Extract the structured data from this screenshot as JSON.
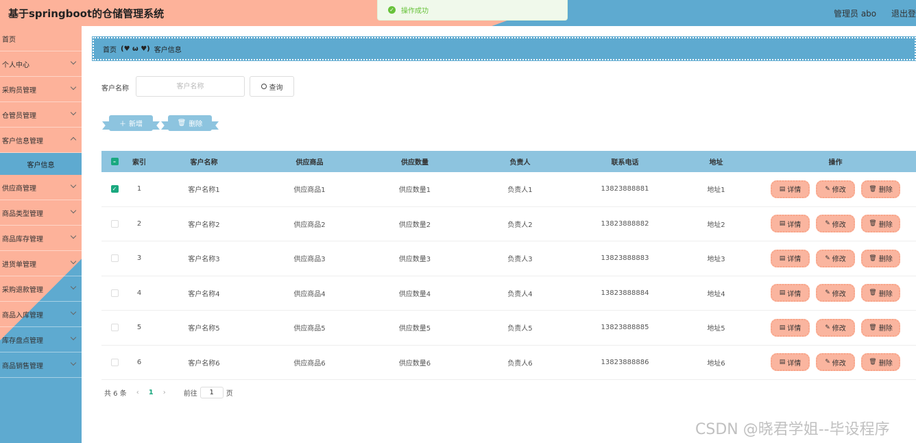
{
  "header": {
    "title": "基于springboot的仓储管理系统",
    "user": "管理员 abo",
    "logout": "退出登"
  },
  "toast": {
    "text": "操作成功",
    "icon": "check-icon",
    "color": "#67c23a"
  },
  "sidebar": {
    "items": [
      {
        "label": "首页"
      },
      {
        "label": "个人中心"
      },
      {
        "label": "采购员管理"
      },
      {
        "label": "仓管员管理"
      },
      {
        "label": "客户信息管理"
      },
      {
        "label": "供应商管理"
      },
      {
        "label": "商品类型管理"
      },
      {
        "label": "商品库存管理"
      },
      {
        "label": "进货单管理"
      },
      {
        "label": "采购退款管理"
      },
      {
        "label": "商品入库管理"
      },
      {
        "label": "库存盘点管理"
      },
      {
        "label": "商品销售管理"
      }
    ],
    "active_sub": "客户信息"
  },
  "breadcrumb": {
    "home": "首页",
    "separator": "(♥ ω ♥)",
    "current": "客户信息"
  },
  "search": {
    "label": "客户名称",
    "placeholder": "客户名称",
    "value": "",
    "button": "查询"
  },
  "actions": {
    "add": "新增",
    "delete": "删除"
  },
  "table": {
    "columns": [
      "索引",
      "客户名称",
      "供应商品",
      "供应数量",
      "负责人",
      "联系电话",
      "地址",
      "操作"
    ],
    "rows": [
      {
        "index": "1",
        "name": "客户名称1",
        "goods": "供应商品1",
        "qty": "供应数量1",
        "owner": "负责人1",
        "phone": "13823888881",
        "addr": "地址1",
        "checked": true
      },
      {
        "index": "2",
        "name": "客户名称2",
        "goods": "供应商品2",
        "qty": "供应数量2",
        "owner": "负责人2",
        "phone": "13823888882",
        "addr": "地址2",
        "checked": false
      },
      {
        "index": "3",
        "name": "客户名称3",
        "goods": "供应商品3",
        "qty": "供应数量3",
        "owner": "负责人3",
        "phone": "13823888883",
        "addr": "地址3",
        "checked": false
      },
      {
        "index": "4",
        "name": "客户名称4",
        "goods": "供应商品4",
        "qty": "供应数量4",
        "owner": "负责人4",
        "phone": "13823888884",
        "addr": "地址4",
        "checked": false
      },
      {
        "index": "5",
        "name": "客户名称5",
        "goods": "供应商品5",
        "qty": "供应数量5",
        "owner": "负责人5",
        "phone": "13823888885",
        "addr": "地址5",
        "checked": false
      },
      {
        "index": "6",
        "name": "客户名称6",
        "goods": "供应商品6",
        "qty": "供应数量6",
        "owner": "负责人6",
        "phone": "13823888886",
        "addr": "地址6",
        "checked": false
      }
    ],
    "row_ops": [
      "详情",
      "修改",
      "删除"
    ]
  },
  "pagination": {
    "total": "共 6 条",
    "current_page": "1",
    "goto_label": "前往",
    "goto_value": "1",
    "page_suffix": "页"
  },
  "watermark": "CSDN @晓君学姐--毕设程序",
  "colors": {
    "peach": "#fdb29a",
    "blue": "#5eaad0",
    "table_header": "#8dc4df",
    "accent": "#1aa87f"
  }
}
